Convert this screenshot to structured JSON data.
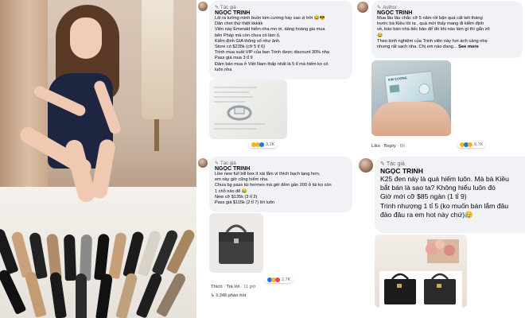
{
  "post1": {
    "tag": "Tác giả",
    "author": "NGỌC TRINH",
    "text": "Lôi ra tường minh buồn kim cương hay sao zị trời 😂😎\nDân chơi thứ thiệt kkkkk\nViên này Emerald hiếm nha mn ơi, dáng hoàng gia mua\nbên Pháp mà còn chưa có làm ố.\nKiểm định GIA thông số như ảnh.\nStore có $235k (cỡ 5 tỉ 6)\nTrinh mua suất VIP của ban Trinh được discount 30% nha\nPass giá mua 3 tỉ 9\nĐảm bảo mua ở Việt Nam thấp nhất là 5 tỉ mà hiếm ko có\nluôn nha",
    "reaction_count": "3,1K"
  },
  "post2": {
    "tag": "Tác giả",
    "author": "NGỌC TRINH",
    "text": "Like new full bill box ít xài lắm vì thích bạch tạng hơn,\nem này giờ cũng hiếm nha.\nChưa bg pass túi hermes mà giờ đếm gần 200 ở túi ko còn\n1 chỗ nào để 😂\nNew cỡ $135k (3 tỉ 2)\nPass giá $115k (2 tỉ 7) lời luôn",
    "like": "Thích",
    "reply": "Trả lời",
    "time": "11 giờ",
    "reaction_count": "2,7K",
    "replies": "3.348 phản hồi"
  },
  "post3": {
    "tag": "Author",
    "author": "NGỌC TRINH",
    "text": "Mua lâu lâu chắc cỡ 5 năm rồi bận quá cất két tháng\ntrước bà Kiều lôi ra , quá mời thấy mang đi kiểm định\nvề, báo bán nhà tiếc bảo để đó khi nào làm gì thì gắn zô\n😂\nTheo kinh nghiệm của Trinh viên này hơi ánh càng nhẹ\nnhưng rất sạch nha. Chị em nào đang...",
    "see_more": "See more",
    "like": "Like",
    "reply": "Reply",
    "time": "6h",
    "reaction_count": "9,7K",
    "card_label": "KIM CƯƠNG"
  },
  "post4": {
    "tag": "Tác giả",
    "author": "NGỌC TRINH",
    "text": "K25 đen này là quá hiếm luôn. Mà bà Kiều\nbắt bán là sao ta? Không hiểu luôn đó\nGiờ mới cỡ $85 ngàn (1 tỉ 9)\nTrinh nhượng 1 tỉ 5 (ko muốn bán lắm đâu\nđào đâu ra em hot này chứ)😥"
  },
  "colors": {
    "like": "#1877f2",
    "love": "#f33e58",
    "haha": "#f7b125"
  }
}
